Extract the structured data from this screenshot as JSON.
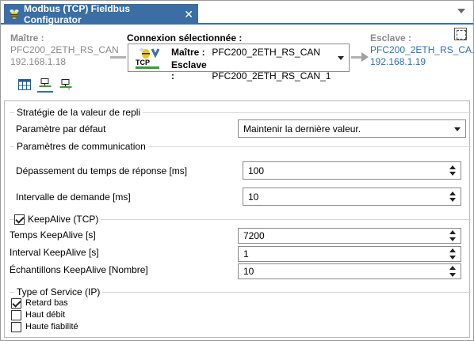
{
  "tab": {
    "title": "Modbus (TCP) Fieldbus Configurator",
    "close": "✕"
  },
  "connection": {
    "master_label": "Maître :",
    "master_name": "PFC200_2ETH_RS_CAN",
    "master_ip": "192.168.1.18",
    "selected_label": "Connexion sélectionnée :",
    "selected_master_key": "Maître :",
    "selected_master_value": "PFC200_2ETH_RS_CAN",
    "selected_slave_key": "Esclave :",
    "selected_slave_value": "PFC200_2ETH_RS_CAN_1",
    "tcp_icon_text": "TCP",
    "slave_label": "Esclave :",
    "slave_name": "PFC200_2ETH_RS_CA...",
    "slave_ip": "192.168.1.19"
  },
  "fallback": {
    "title": "Stratégie de la valeur de repli",
    "default_param_label": "Paramètre par défaut",
    "default_param_value": "Maintenir la dernière valeur."
  },
  "comm": {
    "title": "Paramètres de communication",
    "timeout_label": "Dépassement du temps de réponse [ms]",
    "timeout_value": "100",
    "interval_label": "Intervalle de demande [ms]",
    "interval_value": "10"
  },
  "keepalive": {
    "title": "KeepAlive (TCP)",
    "checked": true,
    "time_label": "Temps KeepAlive [s]",
    "time_value": "7200",
    "interval_label": "Interval KeepAlive [s]",
    "interval_value": "1",
    "samples_label": "Échantillons KeepAlive [Nombre]",
    "samples_value": "10"
  },
  "tos": {
    "title": "Type of Service (IP)",
    "options": [
      {
        "label": "Retard bas",
        "checked": true
      },
      {
        "label": "Haut débit",
        "checked": false
      },
      {
        "label": "Haute fiabilité",
        "checked": false
      }
    ]
  },
  "colors": {
    "accent": "#3a6ea5",
    "link": "#2a6fc9",
    "grey_text": "#8a8a8a"
  }
}
